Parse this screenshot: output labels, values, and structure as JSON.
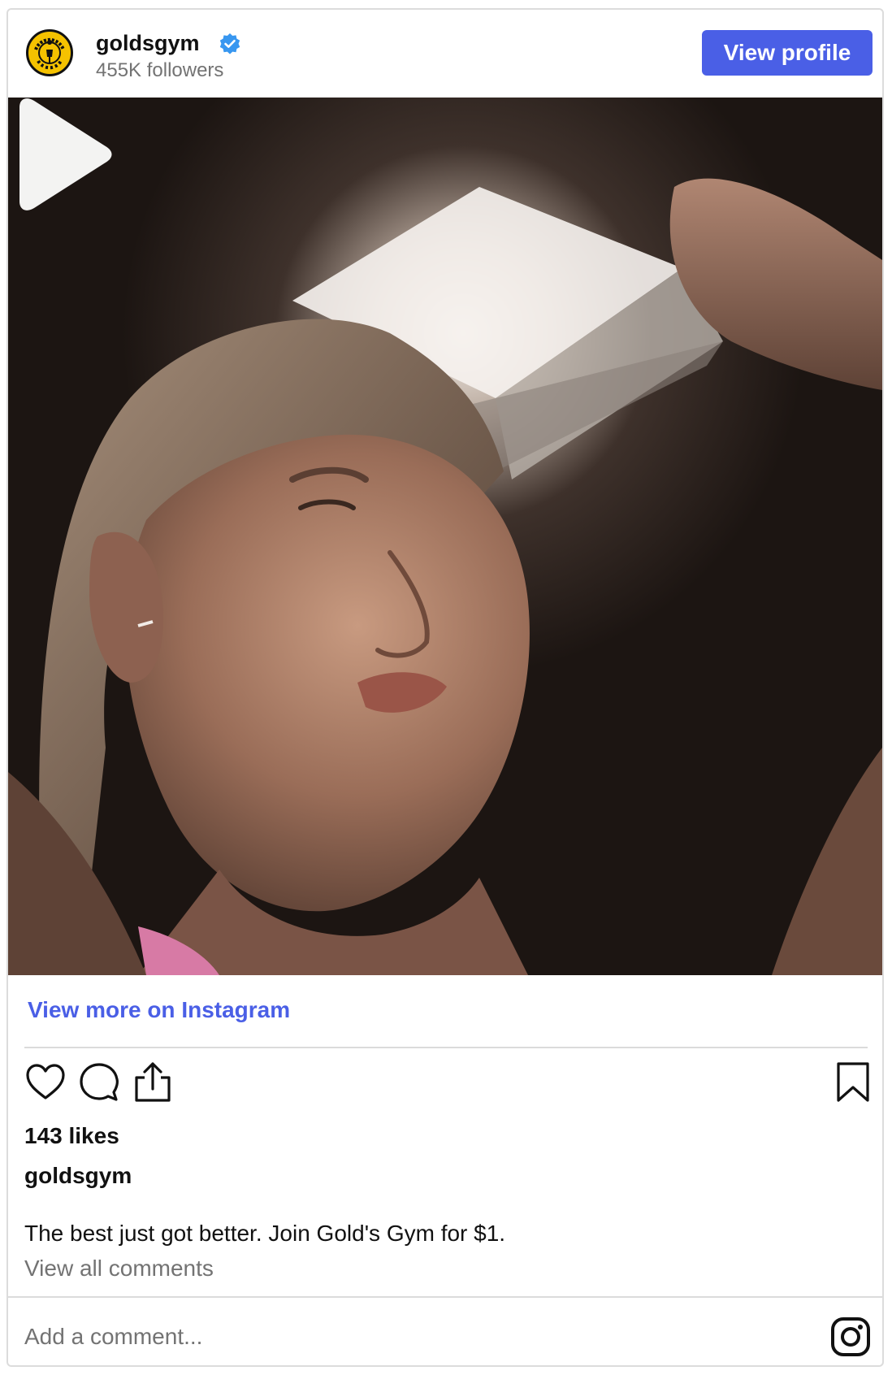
{
  "header": {
    "username": "goldsgym",
    "followers": "455K followers",
    "view_profile_label": "View profile",
    "avatar_text_top": "GOLD'S",
    "avatar_text_bottom": "GYM"
  },
  "post": {
    "view_more_label": "View more on Instagram",
    "likes": "143 likes",
    "caption_username": "goldsgym",
    "caption": "The best just got better. Join Gold's Gym for $1.",
    "view_all_comments": "View all comments",
    "add_comment_placeholder": "Add a comment..."
  },
  "icons": {
    "verified": "verified-badge-icon",
    "play": "play-icon",
    "like": "heart-icon",
    "comment": "comment-bubble-icon",
    "share": "share-icon",
    "save": "bookmark-icon",
    "instagram": "instagram-logo-icon"
  },
  "colors": {
    "accent": "#4a5fe6",
    "verified": "#3897f0",
    "muted": "#737373",
    "avatar_gold": "#f5c200"
  }
}
